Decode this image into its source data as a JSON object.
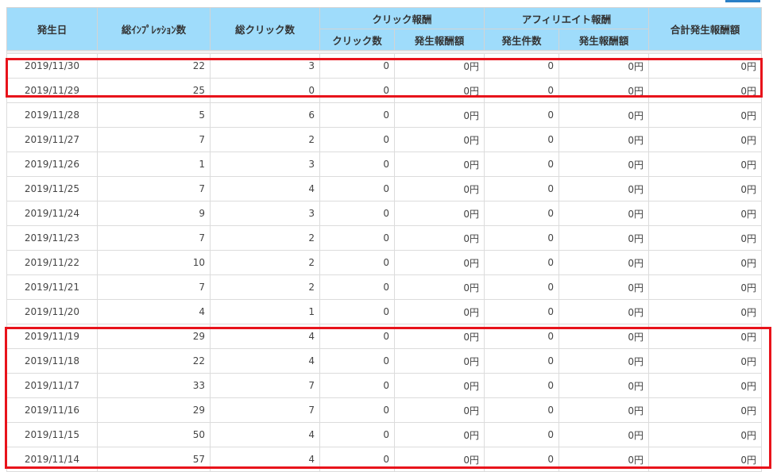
{
  "headers": {
    "date": "発生日",
    "impressions": "総ｲﾝﾌﾟﾚｯｼｮﾝ数",
    "clicks": "総クリック数",
    "click_reward_group": "クリック報酬",
    "click_count": "クリック数",
    "click_reward_amount": "発生報酬額",
    "affiliate_group": "アフィリエイト報酬",
    "affiliate_count": "発生件数",
    "affiliate_reward_amount": "発生報酬額",
    "total_reward": "合計発生報酬額"
  },
  "rows": [
    {
      "date": "2019/11/30",
      "impressions": "22",
      "clicks": "3",
      "click_count": "0",
      "click_reward": "0円",
      "aff_count": "0",
      "aff_reward": "0円",
      "total": "0円"
    },
    {
      "date": "2019/11/29",
      "impressions": "25",
      "clicks": "0",
      "click_count": "0",
      "click_reward": "0円",
      "aff_count": "0",
      "aff_reward": "0円",
      "total": "0円"
    },
    {
      "date": "2019/11/28",
      "impressions": "5",
      "clicks": "6",
      "click_count": "0",
      "click_reward": "0円",
      "aff_count": "0",
      "aff_reward": "0円",
      "total": "0円"
    },
    {
      "date": "2019/11/27",
      "impressions": "7",
      "clicks": "2",
      "click_count": "0",
      "click_reward": "0円",
      "aff_count": "0",
      "aff_reward": "0円",
      "total": "0円"
    },
    {
      "date": "2019/11/26",
      "impressions": "1",
      "clicks": "3",
      "click_count": "0",
      "click_reward": "0円",
      "aff_count": "0",
      "aff_reward": "0円",
      "total": "0円"
    },
    {
      "date": "2019/11/25",
      "impressions": "7",
      "clicks": "4",
      "click_count": "0",
      "click_reward": "0円",
      "aff_count": "0",
      "aff_reward": "0円",
      "total": "0円"
    },
    {
      "date": "2019/11/24",
      "impressions": "9",
      "clicks": "3",
      "click_count": "0",
      "click_reward": "0円",
      "aff_count": "0",
      "aff_reward": "0円",
      "total": "0円"
    },
    {
      "date": "2019/11/23",
      "impressions": "7",
      "clicks": "2",
      "click_count": "0",
      "click_reward": "0円",
      "aff_count": "0",
      "aff_reward": "0円",
      "total": "0円"
    },
    {
      "date": "2019/11/22",
      "impressions": "10",
      "clicks": "2",
      "click_count": "0",
      "click_reward": "0円",
      "aff_count": "0",
      "aff_reward": "0円",
      "total": "0円"
    },
    {
      "date": "2019/11/21",
      "impressions": "7",
      "clicks": "2",
      "click_count": "0",
      "click_reward": "0円",
      "aff_count": "0",
      "aff_reward": "0円",
      "total": "0円"
    },
    {
      "date": "2019/11/20",
      "impressions": "4",
      "clicks": "1",
      "click_count": "0",
      "click_reward": "0円",
      "aff_count": "0",
      "aff_reward": "0円",
      "total": "0円"
    },
    {
      "date": "2019/11/19",
      "impressions": "29",
      "clicks": "4",
      "click_count": "0",
      "click_reward": "0円",
      "aff_count": "0",
      "aff_reward": "0円",
      "total": "0円"
    },
    {
      "date": "2019/11/18",
      "impressions": "22",
      "clicks": "4",
      "click_count": "0",
      "click_reward": "0円",
      "aff_count": "0",
      "aff_reward": "0円",
      "total": "0円"
    },
    {
      "date": "2019/11/17",
      "impressions": "33",
      "clicks": "7",
      "click_count": "0",
      "click_reward": "0円",
      "aff_count": "0",
      "aff_reward": "0円",
      "total": "0円"
    },
    {
      "date": "2019/11/16",
      "impressions": "29",
      "clicks": "7",
      "click_count": "0",
      "click_reward": "0円",
      "aff_count": "0",
      "aff_reward": "0円",
      "total": "0円"
    },
    {
      "date": "2019/11/15",
      "impressions": "50",
      "clicks": "4",
      "click_count": "0",
      "click_reward": "0円",
      "aff_count": "0",
      "aff_reward": "0円",
      "total": "0円"
    },
    {
      "date": "2019/11/14",
      "impressions": "57",
      "clicks": "4",
      "click_count": "0",
      "click_reward": "0円",
      "aff_count": "0",
      "aff_reward": "0円",
      "total": "0円"
    }
  ],
  "colors": {
    "header_bg": "#9fdcfb",
    "highlight_border": "#e8131b",
    "accent_tab": "#2a7fc6"
  }
}
